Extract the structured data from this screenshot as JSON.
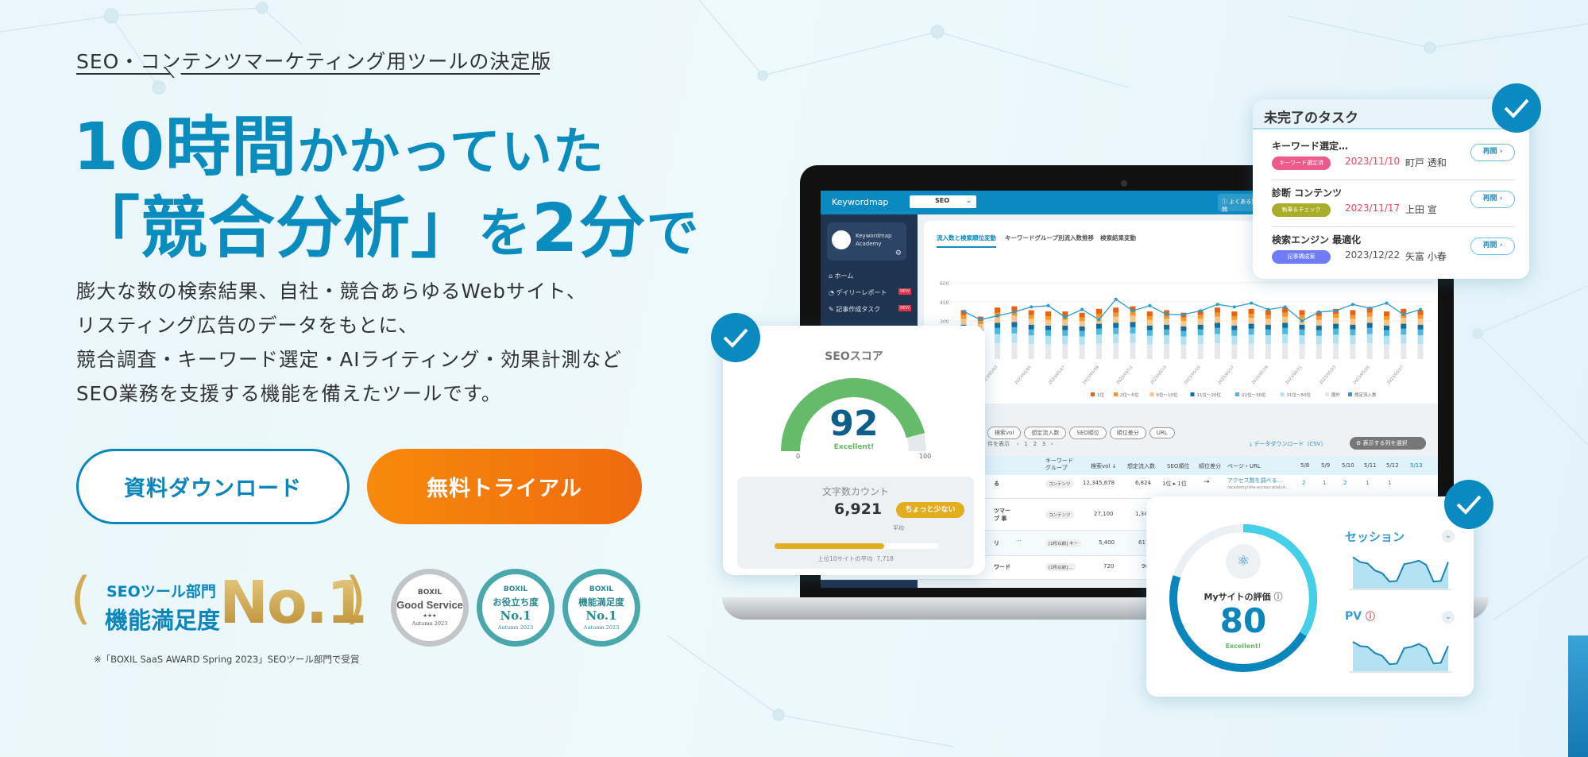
{
  "hero": {
    "eyebrow": "SEO・コンテンツマーケティング用ツールの決定版",
    "headline_line1_big": "10時間",
    "headline_line1_small": "かかっていた",
    "headline_line2_big": "「競合分析」",
    "headline_line2_small": "を",
    "headline_line2_big2": "2分",
    "headline_line2_small2": "で",
    "body": [
      "膨大な数の検索結果、自社・競合あらゆるWebサイト、",
      "リスティング広告のデータをもとに、",
      "競合調査・キーワード選定・AIライティング・効果計測など",
      "SEO業務を支援する機能を備えたツールです。"
    ],
    "download_button": "資料ダウンロード",
    "trial_button": "無料トライアル",
    "colors": {
      "accent": "#0a8cbf",
      "trial": "#f27a0d"
    }
  },
  "award": {
    "dept": "SEOツール部門",
    "title": "機能満足度",
    "rank": "No.1",
    "note": "※「BOXIL SaaS AWARD Spring 2023」SEOツール部門で受賞",
    "badges": [
      {
        "brand": "BOXIL",
        "title": "Good Service",
        "rank": "★★★",
        "season": "Autumn 2023"
      },
      {
        "brand": "BOXIL",
        "title": "お役立ち度",
        "rank": "No.1",
        "season": "Autumn 2023"
      },
      {
        "brand": "BOXIL",
        "title": "機能満足度",
        "rank": "No.1",
        "season": "Autumn 2023"
      }
    ]
  },
  "app": {
    "logo": "Keywordmap",
    "select_value": "SEO",
    "faq": "よくある質問",
    "account": {
      "name_line1": "Keywordmap",
      "name_line2": "Academy"
    },
    "nav": [
      {
        "label": "ホーム",
        "icon": "home-icon"
      },
      {
        "label": "デイリーレポート",
        "icon": "pie-chart-icon",
        "badge": "NEW"
      },
      {
        "label": "記事作成タスク",
        "icon": "edit-icon",
        "badge": "NEW"
      }
    ],
    "tabs": [
      "流入数と検索順位変動",
      "キーワードグループ別流入数推移",
      "検索結果変動"
    ],
    "chart_data": {
      "type": "bar",
      "y_ticks": [
        600,
        450,
        300
      ],
      "ylim": [
        0,
        600
      ],
      "x_labels": [
        "2023/05/01",
        "2023/05/03",
        "2023/05/05",
        "2023/05/07",
        "2023/05/09",
        "2023/05/11",
        "2023/05/13",
        "2023/05/15",
        "2023/05/17",
        "2023/05/19",
        "2023/05/21",
        "2023/05/23",
        "2023/05/25",
        "2023/05/27"
      ],
      "bar_totals": [
        380,
        330,
        400,
        410,
        380,
        370,
        370,
        360,
        390,
        400,
        410,
        370,
        380,
        360,
        380,
        400,
        370,
        390,
        380,
        400,
        380,
        370,
        390,
        380,
        400,
        370,
        390,
        380
      ],
      "line_values": [
        375,
        310,
        340,
        370,
        410,
        420,
        330,
        390,
        310,
        470,
        380,
        420,
        350,
        350,
        380,
        430,
        410,
        440,
        390,
        410,
        300,
        370,
        380,
        430,
        400,
        440,
        350,
        390
      ],
      "legend": [
        {
          "name": "1位",
          "color": "#e8620f"
        },
        {
          "name": "2位〜5位",
          "color": "#f7962a"
        },
        {
          "name": "6位〜10位",
          "color": "#fcc588"
        },
        {
          "name": "11位〜20位",
          "color": "#0f6fa3"
        },
        {
          "name": "21位〜30位",
          "color": "#4cb8e0"
        },
        {
          "name": "31位〜50位",
          "color": "#b3e2f3"
        },
        {
          "name": "圏外",
          "color": "#e6e9ec"
        },
        {
          "name": "想定流入数",
          "color": "#2a9ad0"
        }
      ]
    },
    "chips": [
      "検索vol",
      "想定流入数",
      "SEO順位",
      "順位差分",
      "URL"
    ],
    "pager": {
      "label": "件を表示",
      "prev": "‹",
      "pages": [
        "1",
        "2",
        "3"
      ],
      "next": "›"
    },
    "csv": "データダウンロード（CSV）",
    "columns_button": "表示する列を選択",
    "table": {
      "headers": [
        "キーワードグループ",
        "検索vol ↓",
        "想定流入数",
        "SEO順位",
        "順位差分",
        "ページ・URL",
        "5/8",
        "5/9",
        "5/10",
        "5/11",
        "5/12",
        "5/13"
      ],
      "rows": [
        {
          "kw": "る",
          "group": "コンテンツ",
          "vol": "12,345,678",
          "flow": "6,824",
          "rank": "1位 ▸ 1位",
          "diff": "→",
          "page": "アクセス数を調べる…",
          "url": "/academy/site-access-analysi…",
          "days": [
            "2",
            "1",
            "2",
            "1",
            "1"
          ]
        },
        {
          "kw": "ツマー ブ 事",
          "group": "コンテンツ",
          "vol": "27,100",
          "flow": "1,341"
        },
        {
          "kw": "リ",
          "group": "[1桁以前] キー",
          "vol": "5,400",
          "flow": "617"
        },
        {
          "kw": "ワード",
          "group": "[1桁以前]…",
          "vol": "720",
          "flow": "96"
        }
      ]
    }
  },
  "tasks": {
    "title": "未完了のタスク",
    "items": [
      {
        "title": "キーワード選定…",
        "tag": "キーワード選定済",
        "tag_color": "#ec5a8c",
        "date": "2023/11/10",
        "date_color": "#e84a5a",
        "person": "町戸 透和",
        "button": "再開 ›"
      },
      {
        "title": "診断 コンテンツ",
        "tag": "執筆＆チェック",
        "tag_color": "#a9ad2a",
        "date": "2023/11/17",
        "date_color": "#e84a5a",
        "person": "上田 宣",
        "button": "再開 ›"
      },
      {
        "title": "検索エンジン 最適化",
        "tag": "記事構成案",
        "tag_color": "#6f7cf5",
        "date": "2023/12/22",
        "date_color": "#555555",
        "person": "矢富 小春",
        "button": "再開 ›"
      }
    ]
  },
  "seo_score": {
    "title": "SEOスコア",
    "score": "92",
    "score_value": 92,
    "rating": "Excellent!",
    "min": "0",
    "max": "100",
    "char_count_title": "文字数カウント",
    "char_count": "6,921",
    "char_badge": "ちょっと少ない",
    "avg_label": "平均",
    "avg_note": "上位10サイトの平均",
    "avg_value": "7,718",
    "bar_fraction": 0.67
  },
  "my_site": {
    "title": "Myサイトの評価",
    "score": "80",
    "score_value": 80,
    "rating": "Excellent!",
    "session_label": "セッション",
    "pv_label": "PV",
    "session_values": [
      95,
      88,
      86,
      76,
      72,
      60,
      61,
      85,
      87,
      90,
      84,
      60,
      61,
      88
    ],
    "pv_values": [
      92,
      86,
      85,
      76,
      72,
      60,
      61,
      83,
      85,
      89,
      83,
      61,
      62,
      86
    ]
  }
}
